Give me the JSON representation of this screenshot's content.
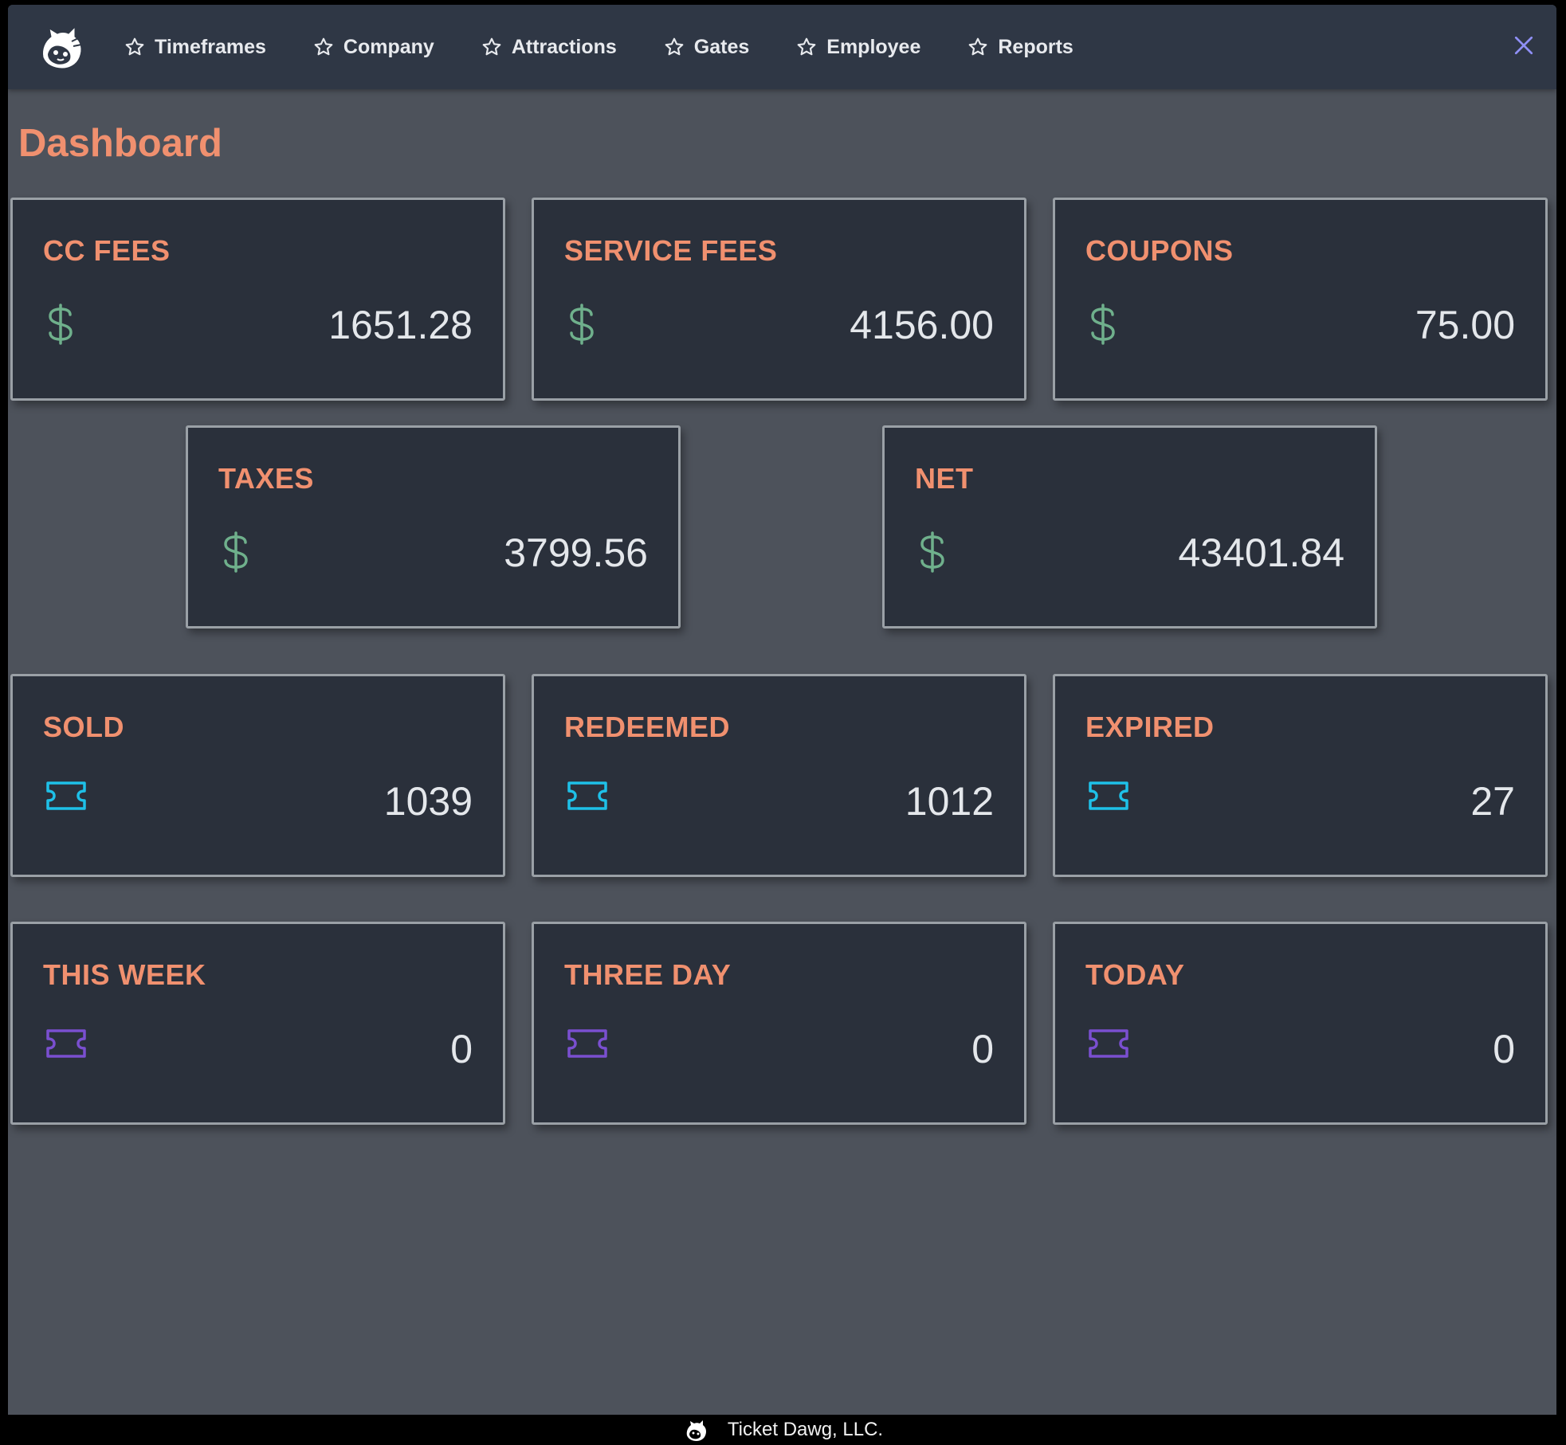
{
  "navbar": {
    "logo_icon": "dog-logo-icon",
    "items": [
      {
        "label": "Timeframes",
        "icon": "star-icon"
      },
      {
        "label": "Company",
        "icon": "star-icon"
      },
      {
        "label": "Attractions",
        "icon": "star-icon"
      },
      {
        "label": "Gates",
        "icon": "star-icon"
      },
      {
        "label": "Employee",
        "icon": "star-icon"
      },
      {
        "label": "Reports",
        "icon": "star-icon"
      }
    ],
    "close_icon": "close-icon"
  },
  "page": {
    "title": "Dashboard"
  },
  "cards": {
    "cc_fees": {
      "title": "CC FEES",
      "icon": "dollar-icon",
      "value": "1651.28"
    },
    "service_fees": {
      "title": "SERVICE FEES",
      "icon": "dollar-icon",
      "value": "4156.00"
    },
    "coupons": {
      "title": "COUPONS",
      "icon": "dollar-icon",
      "value": "75.00"
    },
    "taxes": {
      "title": "TAXES",
      "icon": "dollar-icon",
      "value": "3799.56"
    },
    "net": {
      "title": "NET",
      "icon": "dollar-icon",
      "value": "43401.84"
    },
    "sold": {
      "title": "SOLD",
      "icon": "ticket-icon",
      "value": "1039"
    },
    "redeemed": {
      "title": "REDEEMED",
      "icon": "ticket-icon",
      "value": "1012"
    },
    "expired": {
      "title": "EXPIRED",
      "icon": "ticket-icon",
      "value": "27"
    },
    "this_week": {
      "title": "THIS WEEK",
      "icon": "ticket-icon",
      "value": "0"
    },
    "three_day": {
      "title": "THREE DAY",
      "icon": "ticket-icon",
      "value": "0"
    },
    "today": {
      "title": "TODAY",
      "icon": "ticket-icon",
      "value": "0"
    }
  },
  "colors": {
    "accent": "#f0906f",
    "dollar": "#6fb08c",
    "ticket_cyan": "#1ec0e8",
    "ticket_purple": "#7a4fd0",
    "close": "#8f8ff5"
  },
  "footer": {
    "logo_icon": "dog-logo-icon",
    "text": "Ticket Dawg, LLC."
  }
}
